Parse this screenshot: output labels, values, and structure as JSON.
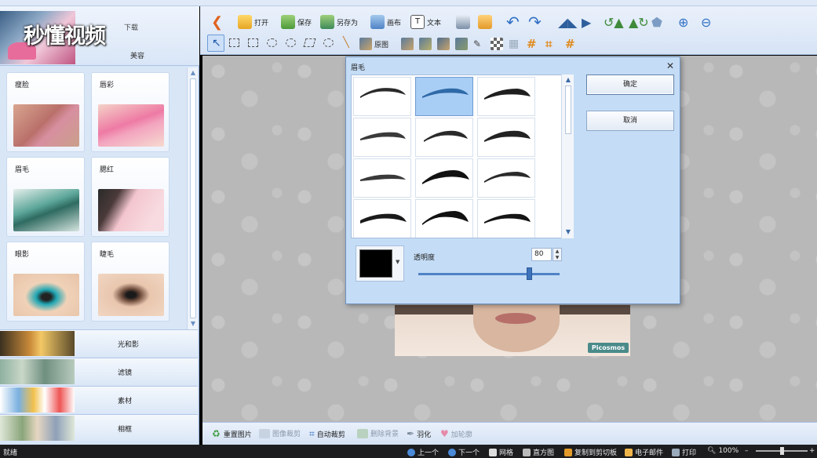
{
  "watermark": "秒懂视频",
  "left_panel": {
    "header_label": "美容",
    "header_label2": "下载",
    "cards": [
      {
        "label": "瘦脸",
        "icon": "lips-kiss-image"
      },
      {
        "label": "唇彩",
        "icon": "lipstick-image"
      },
      {
        "label": "眉毛",
        "icon": "mascara-brush-image"
      },
      {
        "label": "腮红",
        "icon": "blush-brush-image"
      },
      {
        "label": "眼影",
        "icon": "eyeshadow-image"
      },
      {
        "label": "睫毛",
        "icon": "eyelash-image"
      }
    ],
    "categories": [
      {
        "label": "光和影"
      },
      {
        "label": "滤镜"
      },
      {
        "label": "素材"
      },
      {
        "label": "相框"
      }
    ]
  },
  "toolbar": {
    "open": "打开",
    "save": "保存",
    "save_as": "另存为",
    "canvas": "画布",
    "text": "文本",
    "original": "原图"
  },
  "dialog": {
    "title": "眉毛",
    "ok": "确定",
    "cancel": "取消",
    "opacity_label": "透明度",
    "opacity_value": "80",
    "opacity_fraction": 0.8,
    "color": "#000000",
    "selected_index": 1
  },
  "canvas": {
    "brand": "Picosmos"
  },
  "actionbar": {
    "reset": "重置图片",
    "crop_item": "图像裁剪",
    "auto_crop": "自动裁剪",
    "remove_bg": "删除背景",
    "feather": "羽化",
    "add_shape": "加轮廓"
  },
  "statusbar": {
    "ready": "就绪",
    "prev": "上一个",
    "next": "下一个",
    "grid": "网格",
    "histogram": "直方图",
    "copy_clip": "复制到剪切板",
    "email": "电子邮件",
    "print": "打印",
    "zoom": "100%"
  },
  "colors": {
    "accent": "#3d73bb",
    "panel": "#d6e5f8",
    "selected_brow": "#a9cef5"
  }
}
